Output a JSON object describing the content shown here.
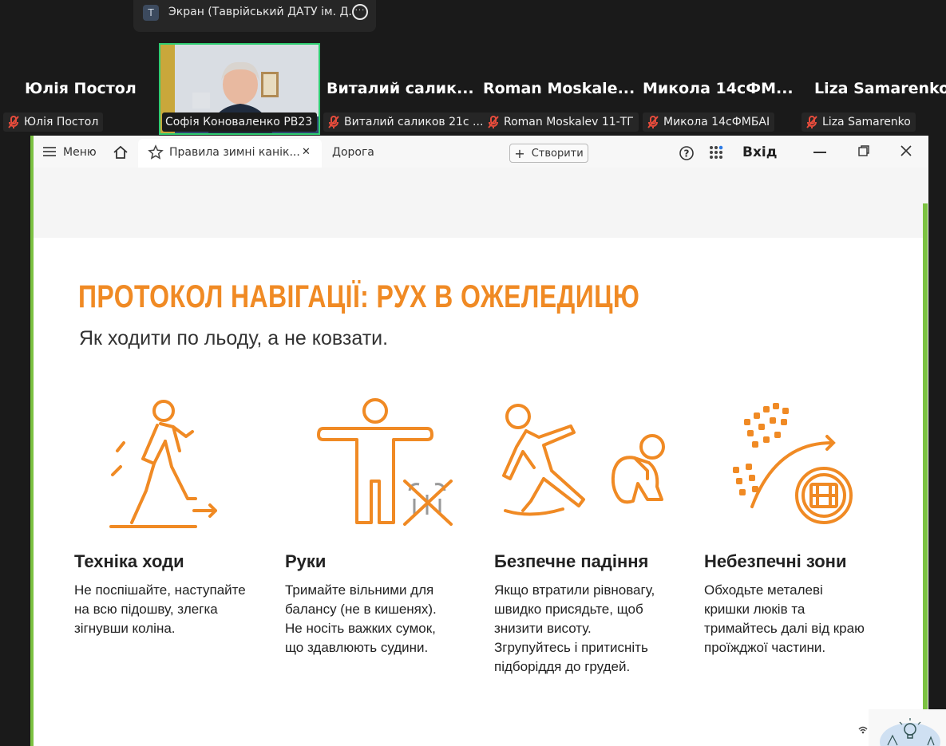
{
  "share": {
    "badge": "T",
    "title": "Экран (Таврійський ДАТУ ім. Д.",
    "more": "···"
  },
  "participants": [
    {
      "name": "Юлія Постол",
      "tag": "Юлія Постол"
    },
    {
      "tag": "Софія Коноваленко РВ23"
    },
    {
      "name": "Виталий  салик...",
      "tag": "Виталий саликов 21с ..."
    },
    {
      "name": "Roman  Moskale...",
      "tag": "Roman Moskalev 11-ТГ"
    },
    {
      "name": "Микола  14сФМ...",
      "tag": "Микола 14сФМБАІ"
    },
    {
      "name": "Liza Samarenko",
      "tag": "Liza Samarenko"
    }
  ],
  "browser": {
    "menu": "Меню",
    "tab_active": "Правила зимні канік...",
    "tab_close": "✕",
    "tab_other": "Дорога",
    "create": "Створити",
    "login": "Вхід"
  },
  "slide": {
    "title": "ПРОТОКОЛ НАВІГАЦІЇ: РУХ В ОЖЕЛЕДИЦЮ",
    "subtitle": "Як ходити по льоду, а не ковзати.",
    "accent_color": "#f08a24",
    "columns": [
      {
        "title": "Техніка ходи",
        "lines": [
          "Не поспішайте, наступайте",
          "на всю підошву, злегка",
          "зігнувши коліна."
        ]
      },
      {
        "title": "Руки",
        "lines": [
          "Тримайте вільними для",
          "балансу (не в кишенях).",
          "Не носіть важких сумок,",
          "що здавлюють судини."
        ]
      },
      {
        "title": "Безпечне падіння",
        "lines": [
          "Якщо втратили рівновагу,",
          "швидко присядьте, щоб",
          "знизити висоту.",
          "Згрупуйтесь і притисніть",
          "підборіддя до грудей."
        ]
      },
      {
        "title": "Небезпечні зони",
        "lines": [
          "Обходьте металеві",
          "кришки люків та",
          "тримайтесь далі від краю",
          "проїжджої частини."
        ]
      }
    ]
  }
}
